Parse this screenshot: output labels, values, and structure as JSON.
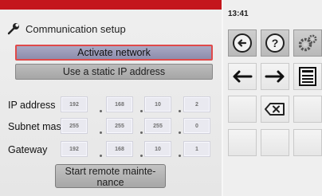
{
  "status": {
    "time": "13:41"
  },
  "header": {
    "title": "Communication setup",
    "icon": "wrench-icon"
  },
  "buttons": {
    "activate_network": "Activate network",
    "static_ip": "Use a static IP address",
    "remote_maintenance": "Start remote mainte-\nnance"
  },
  "fields": [
    {
      "label": "IP address",
      "values": [
        "192",
        "168",
        "10",
        "2"
      ]
    },
    {
      "label": "Subnet mask",
      "values": [
        "255",
        "255",
        "255",
        "0"
      ]
    },
    {
      "label": "Gateway",
      "values": [
        "192",
        "168",
        "10",
        "1"
      ]
    }
  ],
  "keypad": {
    "row1": [
      "back-circle-icon",
      "help-icon",
      "settings-gears-icon"
    ],
    "row2": [
      "arrow-left-icon",
      "arrow-right-icon",
      "save-disk-icon"
    ],
    "row3": [
      "",
      "backspace-icon",
      ""
    ],
    "row4": [
      "",
      "",
      ""
    ]
  },
  "colors": {
    "top_bar": "#c4161c",
    "active_button": "#9b9bb8",
    "active_border": "#e04a4a"
  }
}
